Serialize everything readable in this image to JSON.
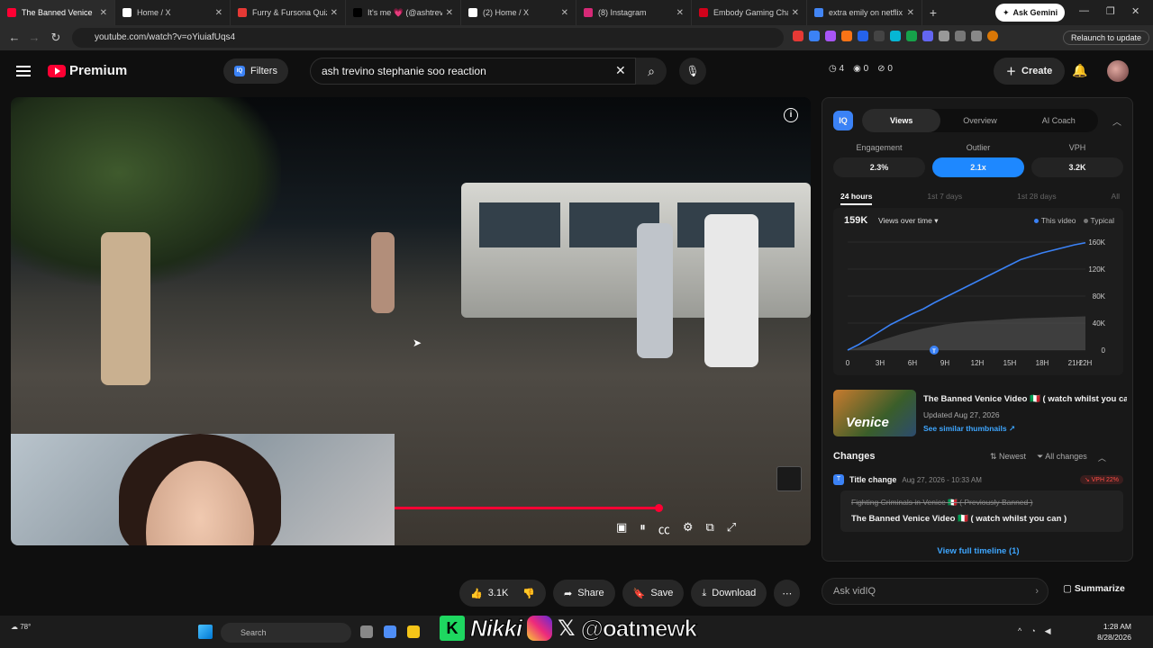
{
  "browser": {
    "tabs": [
      {
        "title": "The Banned Venice",
        "color": "#ff0033",
        "active": true
      },
      {
        "title": "Home / X",
        "color": "#ffffff"
      },
      {
        "title": "Furry & Fursona Quiz",
        "color": "#e53935"
      },
      {
        "title": "It's me 💗 (@ashtrevi",
        "color": "#000000"
      },
      {
        "title": "(2) Home / X",
        "color": "#ffffff"
      },
      {
        "title": "(8) Instagram",
        "color": "#d62976"
      },
      {
        "title": "Embody Gaming Chair",
        "color": "#d0021b"
      },
      {
        "title": "extra emily on netflix",
        "color": "#4285f4"
      }
    ],
    "ask_gemini": "Ask Gemini",
    "url": "youtube.com/watch?v=oYiuiafUqs4",
    "relaunch": "Relaunch to update"
  },
  "youtube": {
    "brand": "Premium",
    "filters": "Filters",
    "search_query": "ash trevino stephanie soo reaction",
    "stats": [
      "4",
      "0",
      "0"
    ],
    "create": "Create"
  },
  "actions": {
    "likes": "3.1K",
    "share": "Share",
    "save": "Save",
    "download": "Download"
  },
  "vidiq": {
    "logo": "IQ",
    "tabs": [
      "Views",
      "Overview",
      "AI Coach"
    ],
    "metrics": [
      {
        "label": "Engagement",
        "value": "2.3%"
      },
      {
        "label": "Outlier",
        "value": "2.1x"
      },
      {
        "label": "VPH",
        "value": "3.2K"
      }
    ],
    "ranges": [
      "24 hours",
      "1st 7 days",
      "1st 28 days",
      "All"
    ],
    "big_views": "159K",
    "views_over_time": "Views over time",
    "legend_this": "This video",
    "legend_typical": "Typical",
    "video_title": "The Banned Venice Video 🇮🇹 ( watch whilst you can )",
    "updated": "Updated Aug 27, 2026",
    "similar": "See similar thumbnails",
    "thumb_text": "Venice",
    "changes": "Changes",
    "newest": "Newest",
    "all_changes": "All changes",
    "event_type": "Title change",
    "event_date": "Aug 27, 2026 - 10:33 AM",
    "event_vph": "VPH 22%",
    "event_tag": "T",
    "old_title": "Fighting Criminals in Venice 🇮🇹 ( Previously Banned )",
    "new_title": "The Banned Venice Video 🇮🇹 ( watch whilst you can )",
    "timeline": "View full timeline (1)",
    "ask": "Ask vidIQ",
    "summarize": "Summarize"
  },
  "chart_data": {
    "type": "area",
    "x": [
      0,
      1,
      2,
      3,
      4,
      5,
      6,
      7,
      8,
      9,
      10,
      11,
      12,
      13,
      14,
      15,
      16,
      17,
      18,
      19,
      20,
      21,
      22
    ],
    "xticks": [
      "0",
      "3H",
      "6H",
      "9H",
      "12H",
      "15H",
      "18H",
      "21H",
      "22H"
    ],
    "xtick_values": [
      0,
      3,
      6,
      9,
      12,
      15,
      18,
      21,
      22
    ],
    "yticks": [
      "0",
      "40K",
      "80K",
      "120K",
      "160K"
    ],
    "ylim": [
      0,
      160000
    ],
    "series": [
      {
        "name": "This video",
        "values": [
          0,
          8000,
          18000,
          28000,
          38000,
          46000,
          54000,
          61000,
          70000,
          78000,
          86000,
          94000,
          102000,
          110000,
          118000,
          126000,
          134000,
          139000,
          144000,
          148000,
          152000,
          156000,
          159000
        ]
      },
      {
        "name": "Typical",
        "values": [
          0,
          4000,
          9000,
          14000,
          19000,
          24000,
          28000,
          32000,
          35000,
          38000,
          40000,
          42000,
          43000,
          44000,
          45000,
          46000,
          47000,
          47500,
          48000,
          48500,
          49000,
          49500,
          50000
        ]
      }
    ],
    "marker_label": "T",
    "marker_x": 8,
    "colors": {
      "this": "#3b82f6",
      "typical": "#5a5a5a"
    }
  },
  "taskbar": {
    "weather": "78°",
    "search": "Search",
    "time": "1:28 AM",
    "date": "8/28/2026"
  },
  "overlay": {
    "k": "K",
    "name": "Nikki",
    "handle": "@oatmewk"
  }
}
